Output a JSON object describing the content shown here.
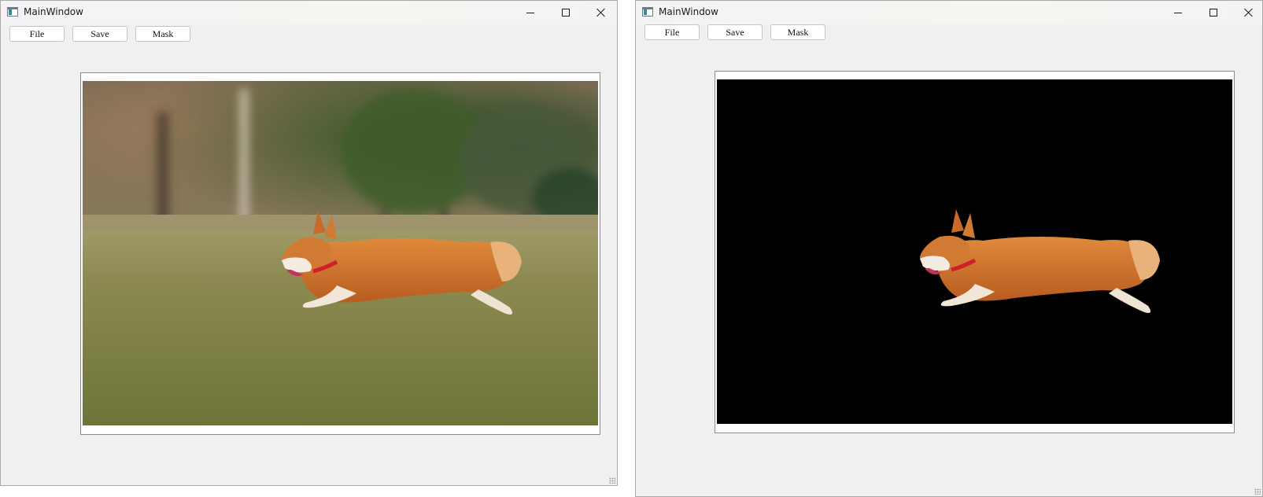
{
  "windows": [
    {
      "title": "MainWindow",
      "buttons": {
        "file": "File",
        "save": "Save",
        "mask": "Mask"
      },
      "image": "original-photo"
    },
    {
      "title": "MainWindow",
      "buttons": {
        "file": "File",
        "save": "Save",
        "mask": "Mask"
      },
      "image": "mask-result"
    }
  ],
  "colors": {
    "window_bg": "#f0f0f0",
    "mask_background": "#000000",
    "dog_fur": "#d4752d"
  }
}
